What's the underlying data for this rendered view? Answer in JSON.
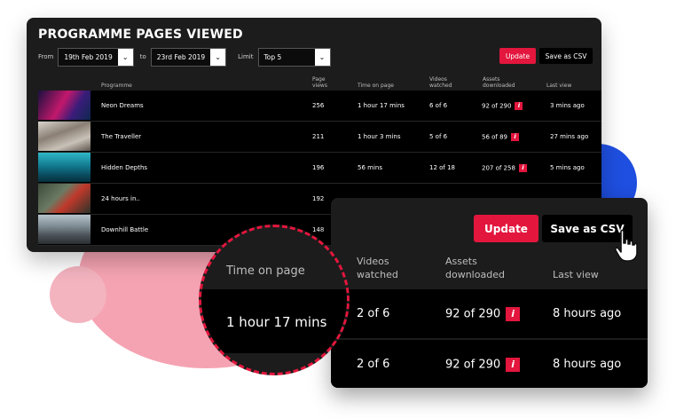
{
  "title": "PROGRAMME PAGES VIEWED",
  "filters": {
    "from_label": "From",
    "from_value": "19th Feb 2019",
    "to_label": "to",
    "to_value": "23rd Feb 2019",
    "limit_label": "Limit",
    "limit_value": "Top 5"
  },
  "buttons": {
    "update": "Update",
    "save_csv": "Save as CSV"
  },
  "columns": {
    "programme": "Programme",
    "page_views": "Page views",
    "time_on_page": "Time on page",
    "videos_watched": "Videos watched",
    "assets_downloaded": "Assets downloaded",
    "last_view": "Last view"
  },
  "rows": [
    {
      "programme": "Neon Dreams",
      "page_views": "256",
      "time": "1 hour 17 mins",
      "videos": "6 of 6",
      "assets": "92 of 290",
      "last": "3 mins ago"
    },
    {
      "programme": "The Traveller",
      "page_views": "211",
      "time": "1 hour 3 mins",
      "videos": "5 of 6",
      "assets": "56 of 89",
      "last": "27 mins ago"
    },
    {
      "programme": "Hidden Depths",
      "page_views": "196",
      "time": "56 mins",
      "videos": "12 of 18",
      "assets": "207 of 258",
      "last": "5 mins ago"
    },
    {
      "programme": "24 hours in..",
      "page_views": "192",
      "time": "",
      "videos": "",
      "assets": "",
      "last": ""
    },
    {
      "programme": "Downhill Battle",
      "page_views": "148",
      "time": "",
      "videos": "",
      "assets": "",
      "last": ""
    }
  ],
  "zoom": {
    "videos_header": "Videos watched",
    "assets_header": "Assets downloaded",
    "last_header": "Last view",
    "rows": [
      {
        "videos": "2 of 6",
        "assets": "92 of 290",
        "last": "8 hours ago"
      },
      {
        "videos": "2 of 6",
        "assets": "92 of 290",
        "last": "8 hours ago"
      }
    ]
  },
  "lens": {
    "label": "Time on page",
    "value": "1 hour 17 mins"
  },
  "info_glyph": "i",
  "colors": {
    "accent": "#e3163d",
    "panel": "#1c1c1c",
    "row": "#000000",
    "blob_pink": "#f5a3b2",
    "blob_blue": "#1f4fe0"
  },
  "icons": {
    "dropdown": "chevron-down-icon",
    "info": "info-icon",
    "cursor": "hand-pointer-icon"
  }
}
